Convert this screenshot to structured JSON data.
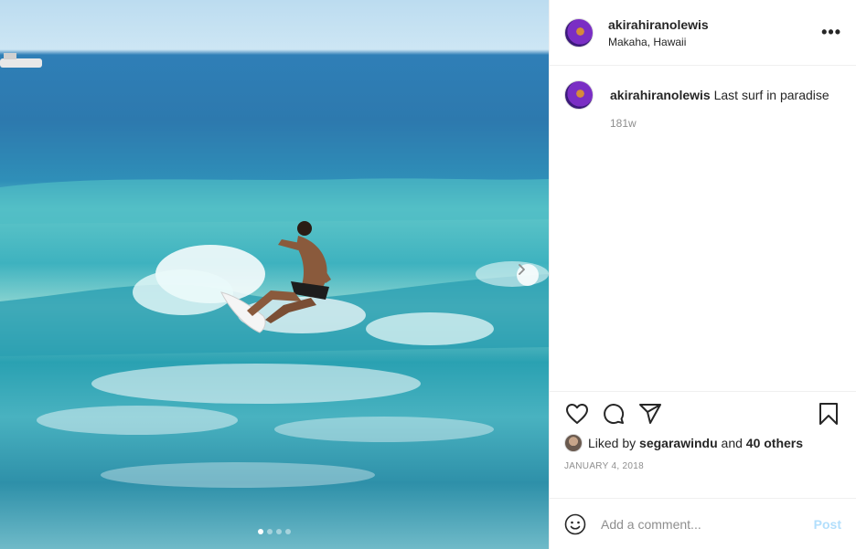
{
  "post": {
    "username": "akirahiranolewis",
    "location": "Makaha, Hawaii",
    "more_label": "•••",
    "caption": {
      "username": "akirahiranolewis",
      "text": "Last surf in paradise",
      "time_ago": "181w"
    },
    "likes": {
      "prefix": "Liked by",
      "user": "segarawindu",
      "conjunction": "and",
      "others": "40 others"
    },
    "date": "JANUARY 4, 2018",
    "comment": {
      "placeholder": "Add a comment...",
      "post_label": "Post"
    },
    "carousel": {
      "count": 4,
      "active_index": 0
    }
  },
  "icons": [
    "chevron-right-icon",
    "heart-icon",
    "comment-icon",
    "share-icon",
    "bookmark-icon",
    "emoji-icon"
  ]
}
